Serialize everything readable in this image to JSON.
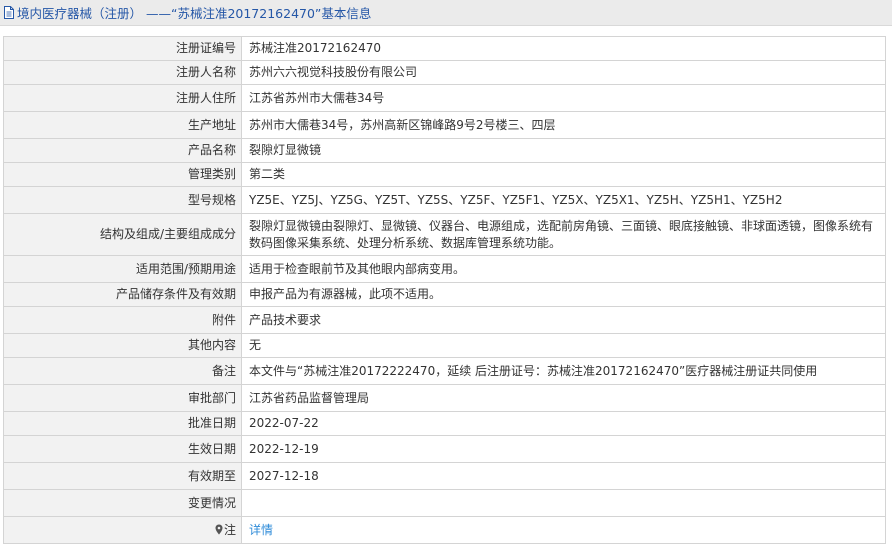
{
  "header": {
    "title": "境内医疗器械（注册） ——“苏械注准20172162470”基本信息"
  },
  "rows": [
    {
      "label": "注册证编号",
      "value": "苏械注准20172162470"
    },
    {
      "label": "注册人名称",
      "value": "苏州六六视觉科技股份有限公司"
    },
    {
      "label": "注册人住所",
      "value": "江苏省苏州市大儒巷34号"
    },
    {
      "label": "生产地址",
      "value": "苏州市大儒巷34号，苏州高新区锦峰路9号2号楼三、四层"
    },
    {
      "label": "产品名称",
      "value": "裂隙灯显微镜"
    },
    {
      "label": "管理类别",
      "value": "第二类"
    },
    {
      "label": "型号规格",
      "value": "YZ5E、YZ5J、YZ5G、YZ5T、YZ5S、YZ5F、YZ5F1、YZ5X、YZ5X1、YZ5H、YZ5H1、YZ5H2"
    },
    {
      "label": "结构及组成/主要组成成分",
      "value": "裂隙灯显微镜由裂隙灯、显微镜、仪器台、电源组成，选配前房角镜、三面镜、眼底接触镜、非球面透镜，图像系统有数码图像采集系统、处理分析系统、数据库管理系统功能。"
    },
    {
      "label": "适用范围/预期用途",
      "value": "适用于检查眼前节及其他眼内部病变用。"
    },
    {
      "label": "产品储存条件及有效期",
      "value": "申报产品为有源器械，此项不适用。"
    },
    {
      "label": "附件",
      "value": "产品技术要求"
    },
    {
      "label": "其他内容",
      "value": "无"
    },
    {
      "label": "备注",
      "value": "本文件与“苏械注准20172222470，延续 后注册证号：苏械注准20172162470”医疗器械注册证共同使用"
    },
    {
      "label": "审批部门",
      "value": "江苏省药品监督管理局"
    },
    {
      "label": "批准日期",
      "value": "2022-07-22"
    },
    {
      "label": "生效日期",
      "value": "2022-12-19"
    },
    {
      "label": "有效期至",
      "value": "2027-12-18"
    },
    {
      "label": "变更情况",
      "value": ""
    }
  ],
  "note": {
    "label": "注",
    "link": "详情"
  },
  "colors": {
    "title": "#2557a7",
    "link": "#2e8bd8",
    "label_bg": "#f2f2f2",
    "border": "#d4d4d4"
  }
}
